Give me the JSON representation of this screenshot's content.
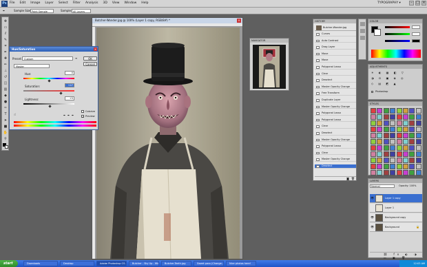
{
  "menubar": {
    "logo": "Ps",
    "items": [
      "File",
      "Edit",
      "Image",
      "Layer",
      "Select",
      "Filter",
      "Analysis",
      "3D",
      "View",
      "Window",
      "Help"
    ],
    "workspace": "TYPOGRAPHY ▾"
  },
  "options": {
    "label1": "Sample Size:",
    "value1": "Point Sample",
    "label2": "Sample:",
    "value2": "All Layers"
  },
  "canvas": {
    "title": "Butcher-Wonder.jpg @ 100% (Layer 1 copy, RGB/8#) *"
  },
  "huesat": {
    "title": "Hue/Saturation",
    "preset_label": "Preset:",
    "preset_value": "Custom",
    "channel_value": "Master",
    "hue_label": "Hue:",
    "hue_value": "0",
    "sat_label": "Saturation:",
    "sat_value": "+47",
    "light_label": "Lightness:",
    "light_value": "+5",
    "ok_label": "OK",
    "cancel_label": "Cancel",
    "colorize_label": "Colorize",
    "preview_label": "Preview",
    "hue_slider_position": 0.5,
    "sat_slider_position": 0.73,
    "light_slider_position": 0.52
  },
  "navigator": {
    "title": "NAVIGATOR"
  },
  "history": {
    "title": "HISTORY",
    "snapshot": "Butcher-Wonder.jpg",
    "items": [
      "Curves",
      "Auto Contrast",
      "Drag Layer",
      "Move",
      "Move",
      "Polygonal Lasso",
      "Clear",
      "Deselect",
      "Master Opacity Change",
      "Free Transform",
      "Duplicate Layer",
      "Master Opacity Change",
      "Polygonal Lasso",
      "Polygonal Lasso",
      "Clear",
      "Deselect",
      "Master Opacity Change",
      "Polygonal Lasso",
      "Clear",
      "Master Opacity Change",
      "Deselect"
    ]
  },
  "panels": {
    "color": "COLOR",
    "adjustments": "ADJUSTMENTS",
    "styles": "STYLES"
  },
  "adjustments": {
    "flag": "Photoshop"
  },
  "layers": {
    "title": "LAYERS",
    "mode": "Normal",
    "opacity": "Opacity: 100%",
    "items": [
      {
        "name": "Layer 1 copy",
        "selected": true
      },
      {
        "name": "Layer 1",
        "selected": false
      },
      {
        "name": "Background copy",
        "selected": false
      },
      {
        "name": "Background",
        "selected": false
      }
    ]
  },
  "taskbar": {
    "start": "start",
    "buttons": [
      "Downloads",
      "Desktop",
      "Adobe Photoshop CS...",
      "Butcher - Sky Up - Win...",
      "Butcher-Teeth.jpg",
      "Sweet pass (Change...",
      "Nice photos here!"
    ],
    "clock": "12:03 AM"
  }
}
